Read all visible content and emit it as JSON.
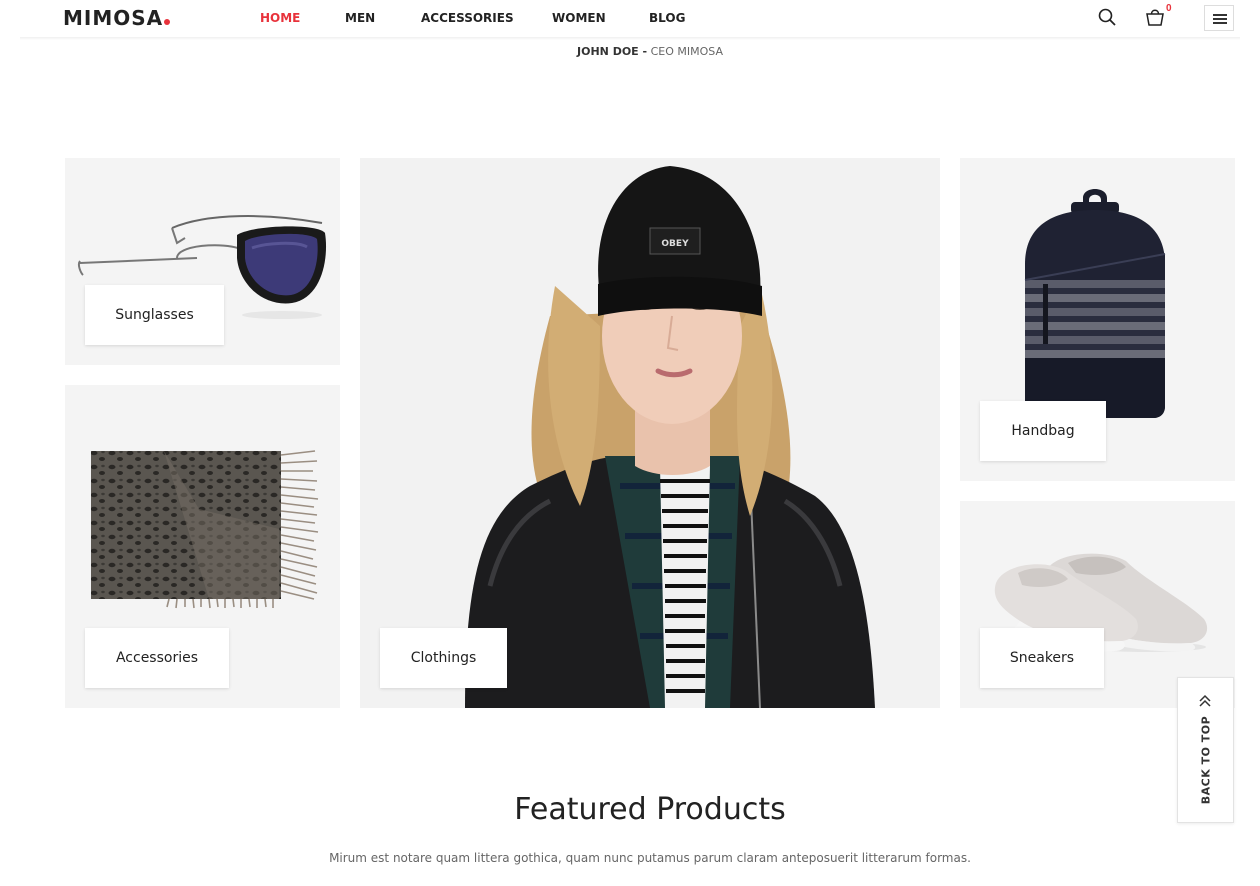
{
  "header": {
    "logo": "MIMOSA",
    "logo_dot_color": "#e8323b",
    "nav": [
      {
        "label": "HOME",
        "active": true
      },
      {
        "label": "MEN",
        "active": false
      },
      {
        "label": "ACCESSORIES",
        "active": false
      },
      {
        "label": "WOMEN",
        "active": false
      },
      {
        "label": "BLOG",
        "active": false
      }
    ],
    "cart_count": "0",
    "accent_color": "#e8323b",
    "icons": [
      "search-icon",
      "cart-icon",
      "hamburger-menu-icon"
    ]
  },
  "testimonial": {
    "author": "JOHN DOE -",
    "role": "CEO MIMOSA"
  },
  "categories": [
    {
      "label": "Sunglasses",
      "image": "sunglasses-image"
    },
    {
      "label": "Accessories",
      "image": "scarf-image"
    },
    {
      "label": "Clothings",
      "image": "model-with-beanie-and-jacket-image"
    },
    {
      "label": "Handbag",
      "image": "backpack-image"
    },
    {
      "label": "Sneakers",
      "image": "slip-on-sneakers-image"
    }
  ],
  "back_to_top": {
    "label": "BACK TO TOP"
  },
  "featured": {
    "title": "Featured Products",
    "subtitle": "Mirum est notare quam littera gothica, quam nunc putamus parum claram anteposuerit litterarum formas."
  }
}
